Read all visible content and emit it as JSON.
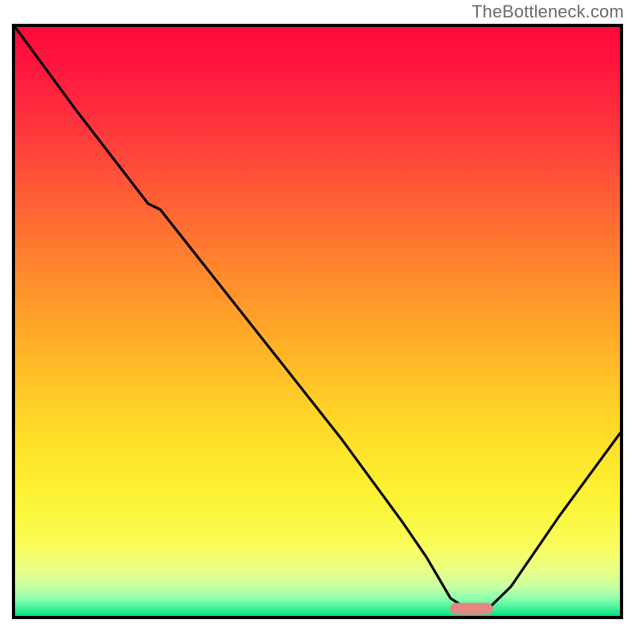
{
  "watermark": "TheBottleneck.com",
  "chart_data": {
    "type": "line",
    "title": "",
    "xlabel": "",
    "ylabel": "",
    "xlim": [
      0,
      100
    ],
    "ylim": [
      0,
      100
    ],
    "grid": false,
    "legend": false,
    "background_gradient": {
      "top": "#ff093a",
      "mid": "#ffd227",
      "bottom": "#02e07a"
    },
    "series": [
      {
        "name": "bottleneck-curve",
        "color": "#000000",
        "x": [
          0,
          10,
          22,
          24,
          34,
          44,
          54,
          64,
          68,
          72,
          75,
          78,
          82,
          90,
          100
        ],
        "y": [
          100,
          86,
          70,
          69,
          56,
          43,
          30,
          16,
          10,
          3,
          1,
          1,
          5,
          17,
          31
        ]
      }
    ],
    "marker": {
      "name": "target-marker",
      "x": 75.5,
      "y": 1.2,
      "color": "#e38781"
    }
  }
}
